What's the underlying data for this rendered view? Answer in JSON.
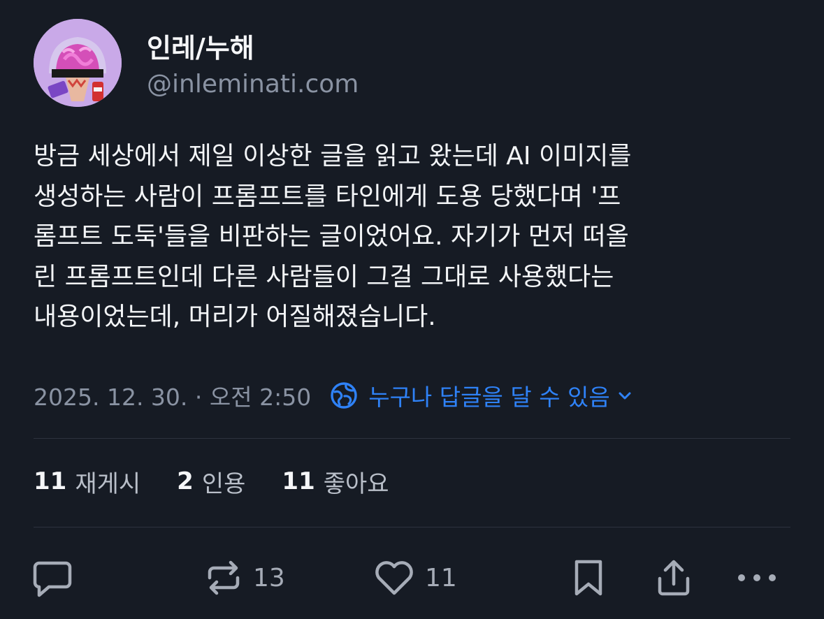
{
  "post": {
    "author": {
      "display_name": "인레/누해",
      "handle": "@inleminati.com"
    },
    "text_lines": [
      "방금 세상에서 제일 이상한 글을 읽고 왔는데 AI 이미지를",
      "생성하는 사람이 프롬프트를 타인에게 도용 당했다며 '프",
      "롬프트 도둑'들을 비판하는 글이었어요. 자기가 먼저 떠올",
      "린 프롬프트인데 다른 사람들이 그걸 그대로 사용했다는",
      "내용이었는데, 머리가 어질해졌습니다."
    ],
    "timestamp": "2025. 12. 30. · 오전 2:50",
    "reply_setting": "누구나 답글을 달 수 있음"
  },
  "stats": {
    "reposts_count": "11",
    "reposts_label": "재게시",
    "quotes_count": "2",
    "quotes_label": "인용",
    "likes_count": "11",
    "likes_label": "좋아요"
  },
  "actions": {
    "reply_icon": "speech-bubble-icon",
    "repost_icon": "repost-arrows-icon",
    "repost_count": "13",
    "like_icon": "heart-icon",
    "like_count": "11",
    "bookmark_icon": "bookmark-icon",
    "share_icon": "share-icon",
    "more_icon": "more-dots-icon"
  },
  "colors": {
    "background": "#161b24",
    "accent": "#2f82f7",
    "muted_text": "#8a93a3"
  }
}
